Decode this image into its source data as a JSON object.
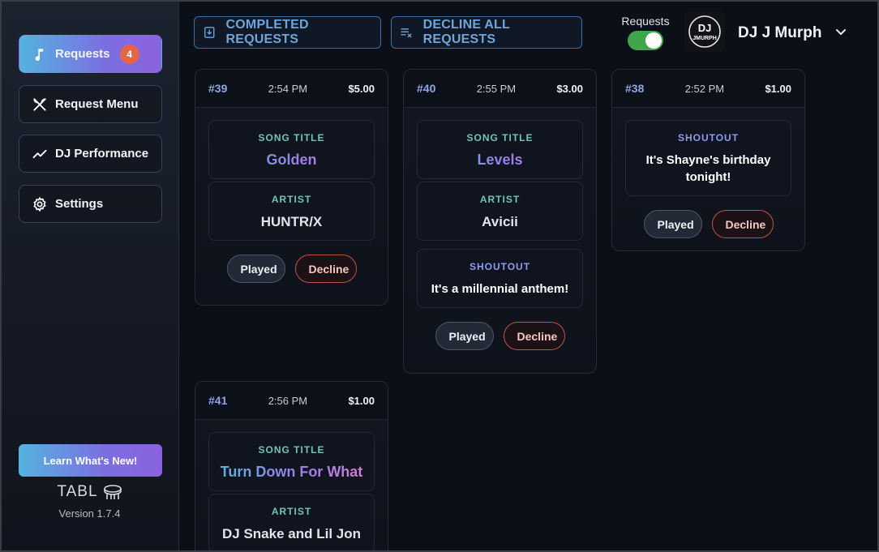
{
  "sidebar": {
    "items": [
      {
        "label": "Requests",
        "badge": "4",
        "icon": "music-note-icon"
      },
      {
        "label": "Request Menu",
        "icon": "utensils-icon"
      },
      {
        "label": "DJ Performance",
        "icon": "trending-up-icon"
      },
      {
        "label": "Settings",
        "icon": "gear-icon"
      }
    ],
    "learn_label": "Learn What's New!",
    "brand": "TABL",
    "version": "Version 1.7.4"
  },
  "header": {
    "completed_label": "COMPLETED REQUESTS",
    "decline_all_label": "DECLINE ALL REQUESTS",
    "toggle_label": "Requests",
    "toggle_on": true,
    "avatar_text_top": "DJ",
    "avatar_text_bottom": "JMURPH",
    "user_name": "DJ J Murph"
  },
  "cards": [
    {
      "num": "#39",
      "time": "2:54 PM",
      "price": "$5.00",
      "song_label": "SONG TITLE",
      "song": "Golden",
      "artist_label": "ARTIST",
      "artist": "HUNTR/X",
      "played": "Played",
      "decline": "Decline"
    },
    {
      "num": "#40",
      "time": "2:55 PM",
      "price": "$3.00",
      "song_label": "SONG TITLE",
      "song": "Levels",
      "artist_label": "ARTIST",
      "artist": "Avicii",
      "shout_label": "SHOUTOUT",
      "shout": "It's a millennial anthem!",
      "played": "Played",
      "decline": "Decline"
    },
    {
      "num": "#38",
      "time": "2:52 PM",
      "price": "$1.00",
      "shout_label": "SHOUTOUT",
      "shout": "It's Shayne's birthday tonight!",
      "played": "Played",
      "decline": "Decline"
    },
    {
      "num": "#41",
      "time": "2:56 PM",
      "price": "$1.00",
      "song_label": "SONG TITLE",
      "song": "Turn Down For What",
      "artist_label": "ARTIST",
      "artist": "DJ Snake and Lil Jon"
    }
  ],
  "colors": {
    "accent_start": "#55b3e0",
    "accent_end": "#8b63df",
    "badge": "#e4654a",
    "toggle_on": "#3fa74a",
    "decline_border": "#b8554e"
  }
}
